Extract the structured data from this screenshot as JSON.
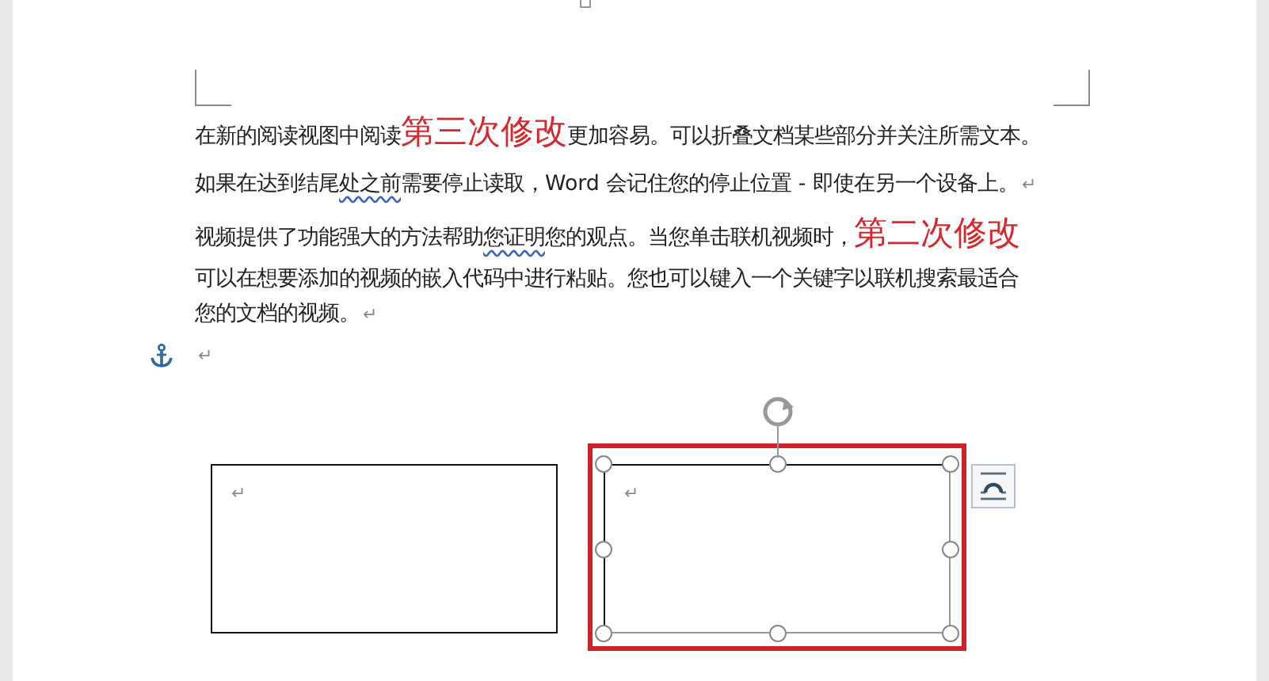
{
  "paragraphs": [
    {
      "lines": [
        {
          "segments": [
            {
              "text": "在新的阅读视图中阅读",
              "kind": "normal"
            },
            {
              "text": "第三次修改",
              "kind": "revision"
            },
            {
              "text": "更加容易。可以折叠文档某些部分并关注所需文本。",
              "kind": "normal"
            }
          ]
        },
        {
          "segments": [
            {
              "text": "如果在达到结尾",
              "kind": "normal"
            },
            {
              "text": "处之前",
              "kind": "flagged"
            },
            {
              "text": "需要停止读取，Word  会记住您的停止位置  -  即使在另一个设备上。",
              "kind": "normal"
            }
          ]
        }
      ],
      "mark": "↵"
    },
    {
      "lines": [
        {
          "segments": [
            {
              "text": "视频提供了功能强大的方法帮助",
              "kind": "normal"
            },
            {
              "text": "您证明",
              "kind": "flagged"
            },
            {
              "text": "您的观点。当您单击联机视频时，",
              "kind": "normal"
            },
            {
              "text": "第二次修改",
              "kind": "revision"
            }
          ]
        },
        {
          "segments": [
            {
              "text": "可以在想要添加的视频的嵌入代码中进行粘贴。您也可以键入一个关键字以联机搜索最适合",
              "kind": "normal"
            }
          ]
        },
        {
          "segments": [
            {
              "text": "您的文档的视频。",
              "kind": "normal"
            }
          ]
        }
      ],
      "mark": "↵"
    },
    {
      "mark": "↵"
    }
  ],
  "text_boxes": [
    {
      "mark": "↵",
      "selected": false
    },
    {
      "mark": "↵",
      "selected": true
    }
  ]
}
